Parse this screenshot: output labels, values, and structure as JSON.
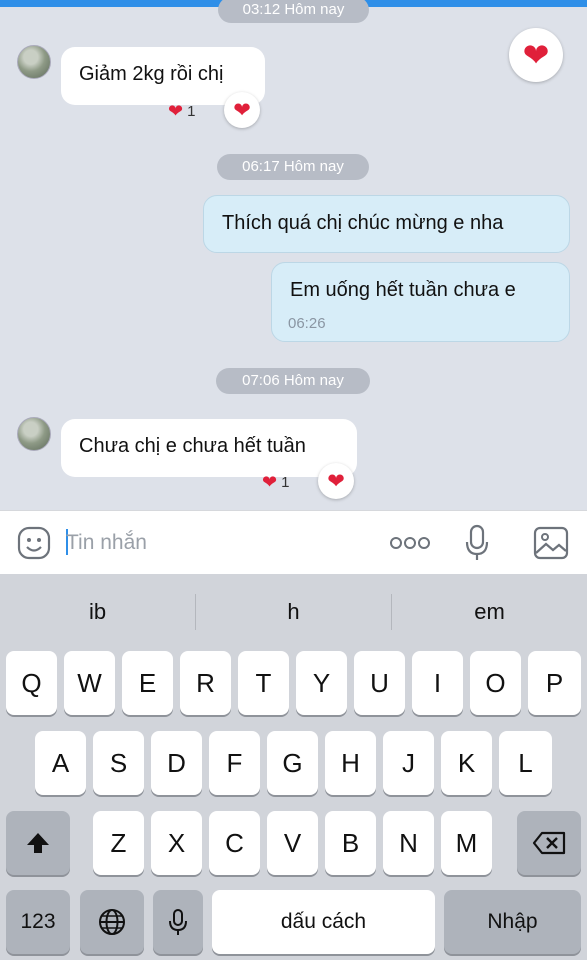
{
  "chat": {
    "time_1": "03:12 Hôm nay",
    "msg_1": "Giảm 2kg rồi chị",
    "msg_1_reaction_count": "1",
    "time_2": "06:17 Hôm nay",
    "msg_2": "Thích quá chị chúc mừng e nha",
    "msg_3": "Em uống hết tuần chưa e",
    "msg_3_time": "06:26",
    "time_3": "07:06 Hôm nay",
    "msg_4": "Chưa chị e chưa hết tuần",
    "msg_4_reaction_count": "1"
  },
  "input": {
    "placeholder": "Tin nhắn",
    "more_icon": "more-dots-icon",
    "mic_icon": "microphone-icon",
    "image_icon": "image-icon",
    "sticker_icon": "sticker-icon"
  },
  "keyboard": {
    "suggestions": [
      "ib",
      "h",
      "em"
    ],
    "row1": [
      "Q",
      "W",
      "E",
      "R",
      "T",
      "Y",
      "U",
      "I",
      "O",
      "P"
    ],
    "row2": [
      "A",
      "S",
      "D",
      "F",
      "G",
      "H",
      "J",
      "K",
      "L"
    ],
    "row3": [
      "Z",
      "X",
      "C",
      "V",
      "B",
      "N",
      "M"
    ],
    "numbers_key": "123",
    "space_key": "dấu cách",
    "return_key": "Nhập",
    "shift_icon": "shift-icon",
    "backspace_icon": "backspace-icon",
    "globe_icon": "globe-icon",
    "dictation_icon": "microphone-icon"
  },
  "colors": {
    "accent": "#2f8fe8",
    "heart": "#e0203a",
    "outgoing_bubble": "#d7edf8",
    "chat_bg": "#dde1e9",
    "keyboard_bg": "#d1d4da"
  }
}
